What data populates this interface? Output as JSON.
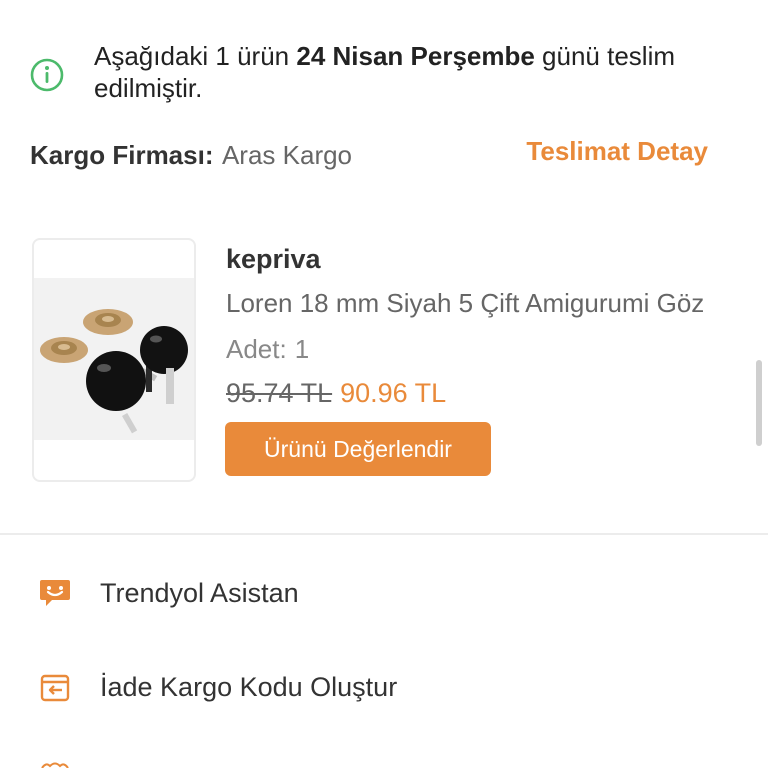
{
  "delivery": {
    "prefix": "Aşağıdaki 1 ürün ",
    "date": "24 Nisan Perşembe",
    "suffix": " günü teslim edilmiştir.",
    "icon": "info-circle-icon",
    "icon_color": "#4cba6b"
  },
  "cargo": {
    "label": "Kargo Firması:",
    "company": "Aras Kargo",
    "detail_link": "Teslimat Detay"
  },
  "product": {
    "seller": "kepriva",
    "title": "Loren 18 mm Siyah 5 Çift Amigurumi Göz",
    "quantity_label": "Adet:",
    "quantity": "1",
    "old_price": "95.74 TL",
    "new_price": "90.96 TL",
    "rate_button": "Ürünü Değerlendir"
  },
  "menu": [
    {
      "label": "Trendyol Asistan",
      "icon": "chat-assistant-icon"
    },
    {
      "label": "İade Kargo Kodu Oluştur",
      "icon": "return-box-icon"
    }
  ],
  "colors": {
    "accent": "#e98a3a",
    "success": "#4cba6b"
  }
}
